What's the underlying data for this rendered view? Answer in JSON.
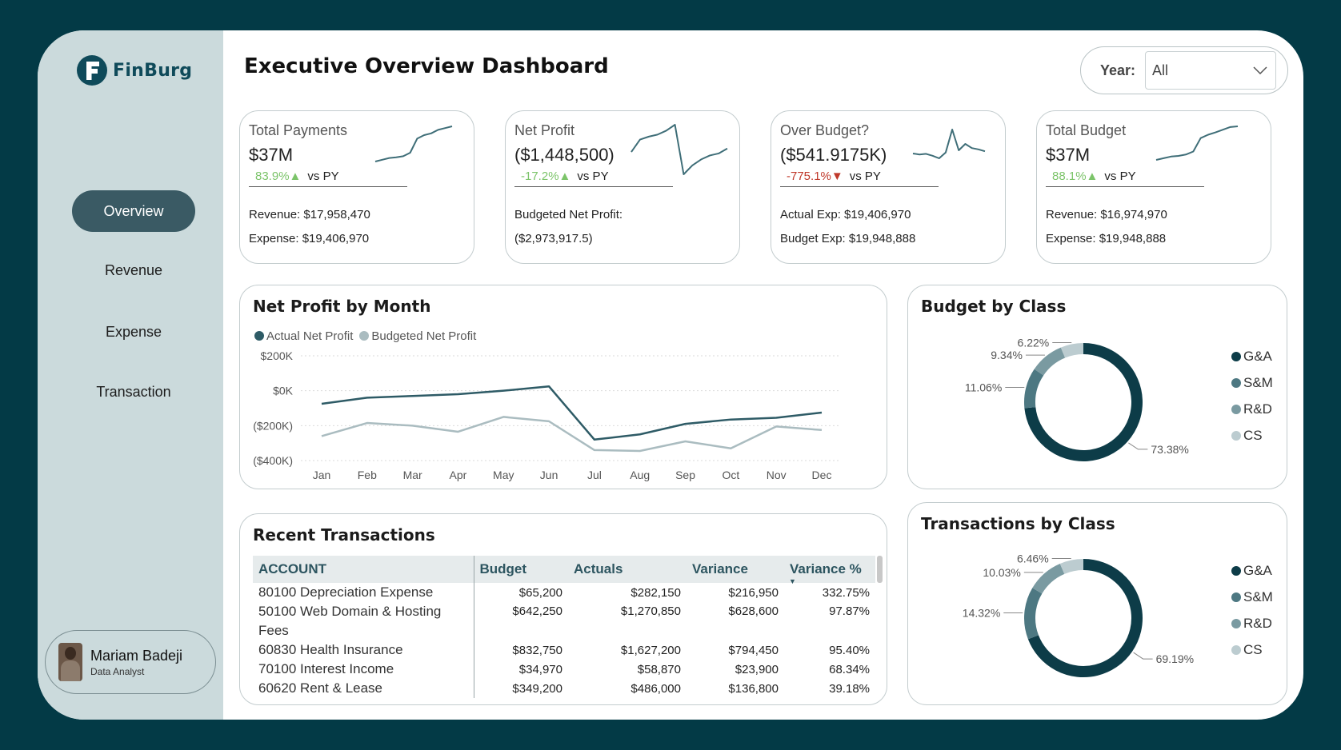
{
  "app": {
    "logo_text": "FinBurg",
    "page_title": "Executive Overview Dashboard"
  },
  "filter": {
    "label": "Year:",
    "value": "All"
  },
  "nav": [
    {
      "label": "Overview",
      "active": true
    },
    {
      "label": "Revenue",
      "active": false
    },
    {
      "label": "Expense",
      "active": false
    },
    {
      "label": "Transaction",
      "active": false
    }
  ],
  "profile": {
    "name": "Mariam Badeji",
    "role": "Data Analyst"
  },
  "kpis": [
    {
      "label": "Total Payments",
      "value": "$37M",
      "pct": "83.9%",
      "direction": "up",
      "vs": "vs PY",
      "line1": "Revenue: $17,958,470",
      "line2": "Expense: $19,406,970",
      "sparkline": [
        0,
        0.05,
        0.1,
        0.12,
        0.15,
        0.25,
        0.65,
        0.75,
        0.8,
        0.9,
        0.95,
        1
      ]
    },
    {
      "label": "Net Profit",
      "value": "($1,448,500)",
      "pct": "-17.2%",
      "direction": "up",
      "vs": "vs PY",
      "line1": "Budgeted Net Profit:",
      "line2": "($2,973,917.5)",
      "sparkline": [
        0.45,
        0.7,
        0.76,
        0.8,
        0.88,
        1.0,
        0.0,
        0.18,
        0.3,
        0.38,
        0.42,
        0.52
      ]
    },
    {
      "label": "Over Budget?",
      "value": "($541.9175K)",
      "pct": "-775.1%",
      "direction": "down",
      "vs": "vs PY",
      "line1": "Actual Exp: $19,406,970",
      "line2": "Budget Exp: $19,948,888",
      "sparkline": [
        0.25,
        0.22,
        0.24,
        0.18,
        0.1,
        0.28,
        1.0,
        0.35,
        0.55,
        0.42,
        0.38,
        0.32
      ]
    },
    {
      "label": "Total Budget",
      "value": "$37M",
      "pct": "88.1%",
      "direction": "up",
      "vs": "vs PY",
      "line1": "Revenue: $16,974,970",
      "line2": "Expense: $19,948,888",
      "sparkline": [
        0,
        0.05,
        0.1,
        0.12,
        0.16,
        0.25,
        0.65,
        0.75,
        0.82,
        0.9,
        0.98,
        1
      ]
    }
  ],
  "net_profit_chart": {
    "title": "Net Profit by Month",
    "legend": [
      "Actual Net Profit",
      "Budgeted Net Profit"
    ]
  },
  "transactions": {
    "title": "Recent Transactions",
    "columns": [
      "ACCOUNT",
      "Budget",
      "Actuals",
      "Variance",
      "Variance %"
    ],
    "rows": [
      [
        "80100 Depreciation Expense",
        "$65,200",
        "$282,150",
        "$216,950",
        "332.75%"
      ],
      [
        "50100 Web Domain & Hosting Fees",
        "$642,250",
        "$1,270,850",
        "$628,600",
        "97.87%"
      ],
      [
        "60830 Health Insurance",
        "$832,750",
        "$1,627,200",
        "$794,450",
        "95.40%"
      ],
      [
        "70100 Interest Income",
        "$34,970",
        "$58,870",
        "$23,900",
        "68.34%"
      ],
      [
        "60620 Rent & Lease",
        "$349,200",
        "$486,000",
        "$136,800",
        "39.18%"
      ]
    ]
  },
  "budget_by_class_title": "Budget by Class",
  "transactions_by_class_title": "Transactions by Class",
  "chart_data": [
    {
      "type": "line",
      "title": "Net Profit by Month",
      "categories": [
        "Jan",
        "Feb",
        "Mar",
        "Apr",
        "May",
        "Jun",
        "Jul",
        "Aug",
        "Sep",
        "Oct",
        "Nov",
        "Dec"
      ],
      "series": [
        {
          "name": "Actual Net Profit",
          "color": "#2e5b66",
          "values": [
            -75,
            -40,
            -30,
            -20,
            0,
            25,
            -280,
            -250,
            -190,
            -165,
            -155,
            -125
          ]
        },
        {
          "name": "Budgeted Net Profit",
          "color": "#aabcc0",
          "values": [
            -260,
            -185,
            -200,
            -235,
            -150,
            -175,
            -340,
            -345,
            -290,
            -330,
            -205,
            -225
          ]
        }
      ],
      "yticks": [
        "$200K",
        "$0K",
        "($200K)",
        "($400K)"
      ],
      "ylim": [
        -400,
        200
      ],
      "grid": true,
      "legend": "top-left"
    },
    {
      "type": "pie",
      "title": "Budget by Class",
      "labels": [
        "G&A",
        "S&M",
        "R&D",
        "CS"
      ],
      "values": [
        73.38,
        11.06,
        9.34,
        6.22
      ],
      "value_labels": [
        "73.38%",
        "11.06%",
        "9.34%",
        "6.22%"
      ],
      "colors": [
        "#0d3c48",
        "#4d7882",
        "#7a9aa1",
        "#bcccd0"
      ],
      "legend": "right"
    },
    {
      "type": "pie",
      "title": "Transactions by Class",
      "labels": [
        "G&A",
        "S&M",
        "R&D",
        "CS"
      ],
      "values": [
        69.19,
        14.32,
        10.03,
        6.46
      ],
      "value_labels": [
        "69.19%",
        "14.32%",
        "10.03%",
        "6.46%"
      ],
      "colors": [
        "#0d3c48",
        "#4d7882",
        "#7a9aa1",
        "#bcccd0"
      ],
      "legend": "right"
    }
  ]
}
